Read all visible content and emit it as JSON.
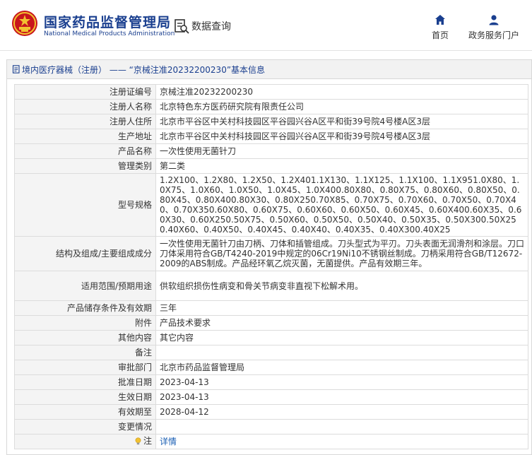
{
  "header": {
    "brand_cn": "国家药品监督管理局",
    "brand_en": "National Medical Products Administration",
    "query_label": "数据查询",
    "nav": [
      {
        "label": "首页",
        "icon": "home-icon"
      },
      {
        "label": "政务服务门户",
        "icon": "user-icon"
      }
    ]
  },
  "panel": {
    "title": "境内医疗器械（注册） —— “京械注准20232200230”基本信息",
    "rows": [
      {
        "key": "注册证编号",
        "value": "京械注准20232200230"
      },
      {
        "key": "注册人名称",
        "value": "北京特色东方医药研究院有限责任公司"
      },
      {
        "key": "注册人住所",
        "value": "北京市平谷区中关村科技园区平谷园兴谷A区平和街39号院4号楼A区3层"
      },
      {
        "key": "生产地址",
        "value": "北京市平谷区中关村科技园区平谷园兴谷A区平和街39号院4号楼A区3层"
      },
      {
        "key": "产品名称",
        "value": "一次性使用无菌针刀"
      },
      {
        "key": "管理类别",
        "value": "第二类"
      },
      {
        "key": "型号规格",
        "value": "1.2X100、1.2X80、1.2X50、1.2X401.1X130、1.1X125、1.1X100、1.1X951.0X80、1.0X75、1.0X60、1.0X50、1.0X45、1.0X400.80X80、0.80X75、0.80X60、0.80X50、0.80X45、0.80X400.80X30、0.80X250.70X85、0.70X75、0.70X60、0.70X50、0.70X40、0.70X350.60X80、0.60X75、0.60X60、0.60X50、0.60X45、0.60X400.60X35、0.60X30、0.60X250.50X75、0.50X60、0.50X50、0.50X40、0.50X35、0.50X300.50X250.40X60、0.40X50、0.40X45、0.40X40、0.40X35、0.40X300.40X25"
      },
      {
        "key": "结构及组成/主要组成成分",
        "value": "一次性使用无菌针刀由刀柄、刀体和插管组成。刀头型式为平刃。刀头表面无润滑剂和涂层。刀口刀体采用符合GB/T4240-2019中规定的06Cr19Ni10不锈钢丝制成。刀柄采用符合GB/T12672-2009的ABS制成。产品经环氧乙烷灭菌，无菌提供。产品有效期三年。"
      },
      {
        "key": "适用范围/预期用途",
        "value": "供软组织损伤性病变和骨关节病变非直视下松解术用。"
      },
      {
        "key": "产品储存条件及有效期",
        "value": "三年"
      },
      {
        "key": "附件",
        "value": "产品技术要求"
      },
      {
        "key": "其他内容",
        "value": "其它内容"
      },
      {
        "key": "备注",
        "value": ""
      },
      {
        "key": "审批部门",
        "value": "北京市药品监督管理局"
      },
      {
        "key": "批准日期",
        "value": "2023-04-13"
      },
      {
        "key": "生效日期",
        "value": "2023-04-13"
      },
      {
        "key": "有效期至",
        "value": "2028-04-12"
      },
      {
        "key": "变更情况",
        "value": ""
      },
      {
        "key": "注",
        "value": "详情"
      }
    ]
  },
  "colors": {
    "brand_blue": "#1a3f8f",
    "link_blue": "#1a5fb4",
    "emblem_red": "#c8161d",
    "emblem_gold": "#f2c230"
  }
}
